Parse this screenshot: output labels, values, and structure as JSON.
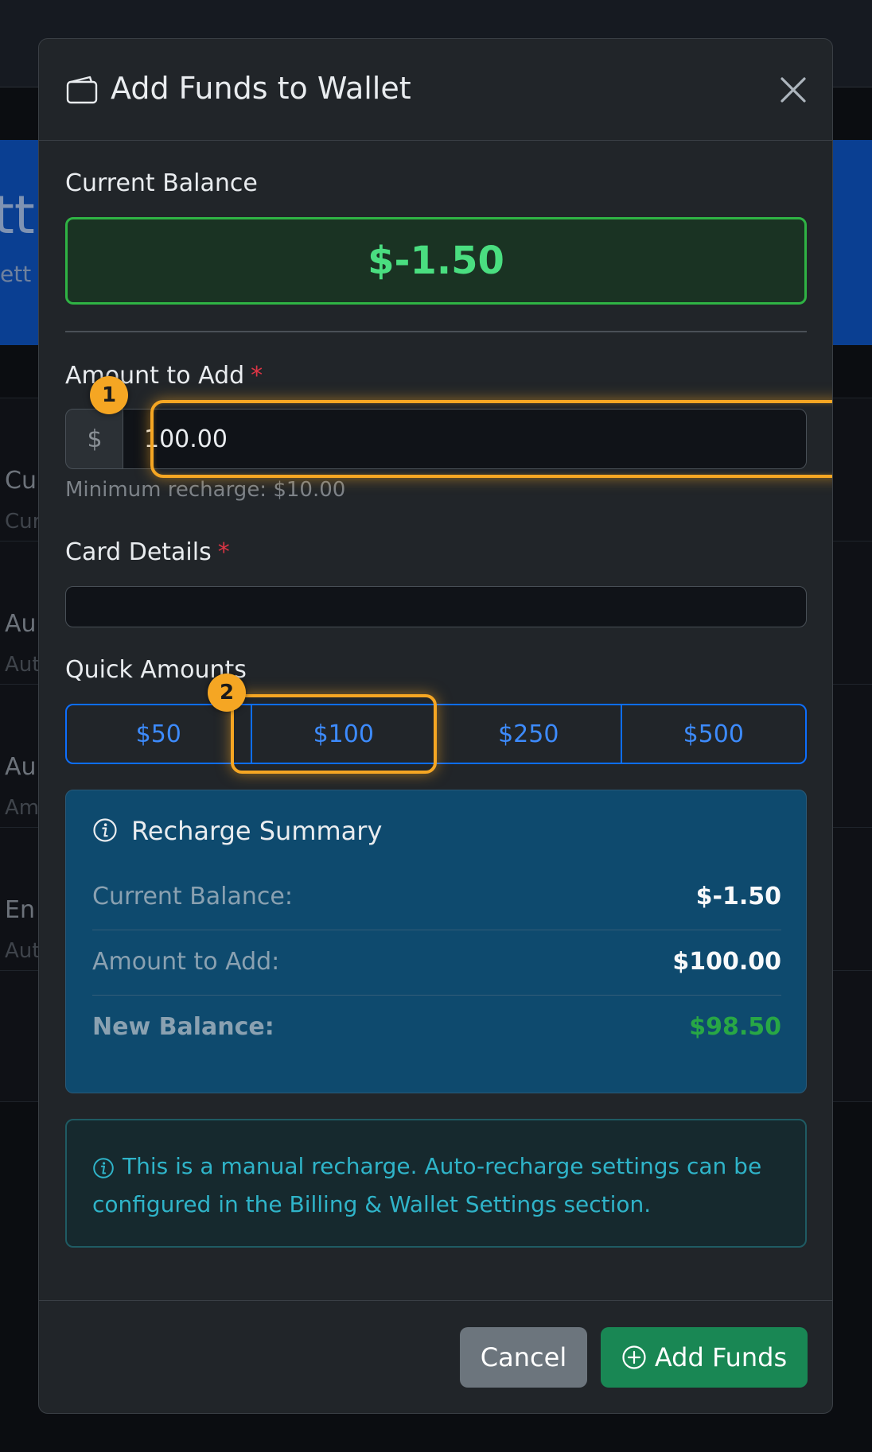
{
  "background": {
    "hero_title": "tt",
    "hero_subtitle": "ett",
    "rows": [
      {
        "title": "Cu",
        "subtitle": "Cur"
      },
      {
        "title": "Au",
        "subtitle": "Aut"
      },
      {
        "title": "Au",
        "subtitle": "Am"
      },
      {
        "title": "En",
        "subtitle": "Aut"
      }
    ]
  },
  "modal": {
    "title": "Add Funds to Wallet",
    "current_balance_label": "Current Balance",
    "current_balance_value": "$-1.50",
    "amount_label": "Amount to Add",
    "required_mark": "*",
    "currency_prefix": "$",
    "amount_value": "100.00",
    "min_recharge_help": "Minimum recharge: $10.00",
    "card_details_label": "Card Details",
    "quick_amounts_label": "Quick Amounts",
    "quick_amounts": [
      "$50",
      "$100",
      "$250",
      "$500"
    ],
    "summary": {
      "title": "Recharge Summary",
      "rows": [
        {
          "label": "Current Balance:",
          "value": "$-1.50"
        },
        {
          "label": "Amount to Add:",
          "value": "$100.00"
        },
        {
          "label": "New Balance:",
          "value": "$98.50"
        }
      ]
    },
    "info_text": "This is a manual recharge. Auto-recharge settings can be configured in the Billing & Wallet Settings section.",
    "cancel_label": "Cancel",
    "add_funds_label": "Add Funds"
  },
  "annotations": {
    "badge_1": "1",
    "badge_2": "2"
  },
  "colors": {
    "accent_orange": "#f5a623",
    "primary_blue": "#0d6efd",
    "success_green": "#198754",
    "balance_green": "#4ade80"
  }
}
